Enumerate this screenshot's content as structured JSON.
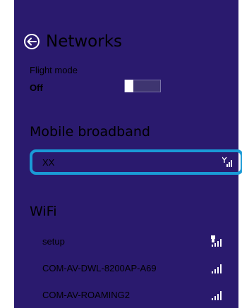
{
  "header": {
    "title": "Networks",
    "back_icon": "back-arrow-icon"
  },
  "flight_mode": {
    "label": "Flight mode",
    "state": "Off",
    "enabled": false
  },
  "mobile_broadband": {
    "title": "Mobile broadband",
    "networks": [
      {
        "name": "XX",
        "icon": "mobile-signal-icon",
        "selected": true
      }
    ]
  },
  "wifi": {
    "title": "WiFi",
    "networks": [
      {
        "name": "setup",
        "icon": "wifi-secured-signal-icon"
      },
      {
        "name": "COM-AV-DWL-8200AP-A69",
        "icon": "wifi-signal-icon"
      },
      {
        "name": "COM-AV-ROAMING2",
        "icon": "wifi-signal-icon"
      }
    ]
  },
  "colors": {
    "panel_background": "#2a1a6e",
    "selection_border": "#1a9ad6",
    "text": "#ffffff"
  }
}
